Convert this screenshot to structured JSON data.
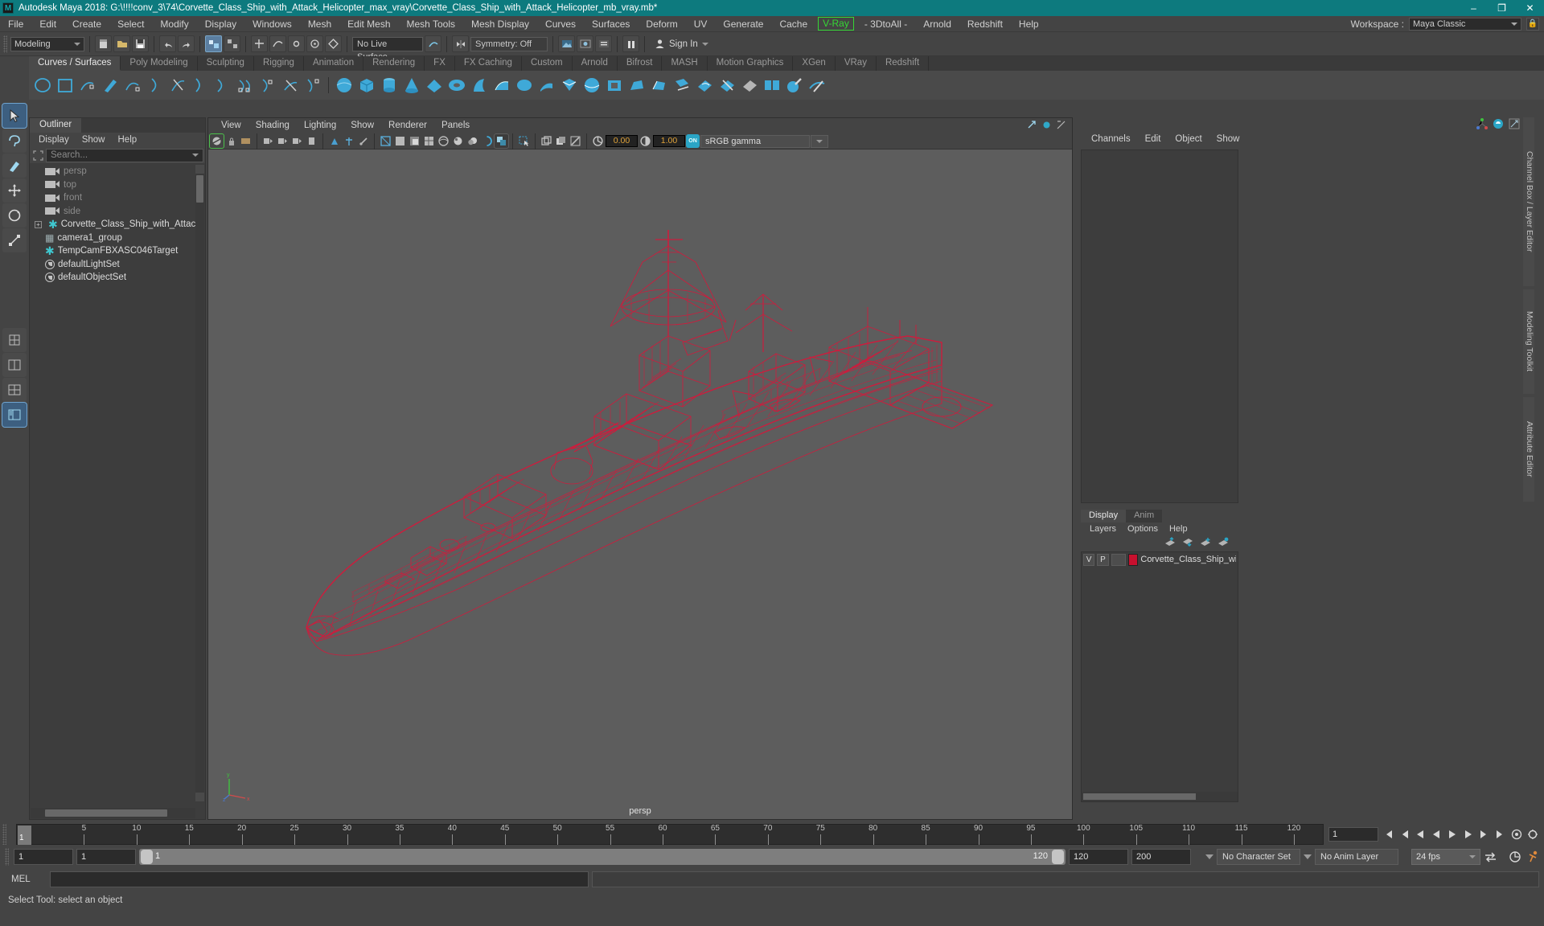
{
  "titlebar": {
    "app_title": "Autodesk Maya 2018: G:\\!!!!conv_3\\74\\Corvette_Class_Ship_with_Attack_Helicopter_max_vray\\Corvette_Class_Ship_with_Attack_Helicopter_mb_vray.mb*",
    "logo_letter": "M",
    "minimize": "–",
    "maximize": "❐",
    "close": "✕"
  },
  "menubar": {
    "items": [
      "File",
      "Edit",
      "Create",
      "Select",
      "Modify",
      "Display",
      "Windows",
      "Mesh",
      "Edit Mesh",
      "Mesh Tools",
      "Mesh Display",
      "Curves",
      "Surfaces",
      "Deform",
      "UV",
      "Generate",
      "Cache"
    ],
    "vray": "V-Ray",
    "after_vray": [
      "- 3DtoAll -",
      "Arnold",
      "Redshift",
      "Help"
    ],
    "workspace_label": "Workspace :",
    "workspace_value": "Maya Classic"
  },
  "statusline": {
    "mode": "Modeling",
    "no_live_surface": "No Live Surface",
    "symmetry": "Symmetry: Off",
    "signin": "Sign In"
  },
  "shelf": {
    "tabs": [
      "Curves / Surfaces",
      "Poly Modeling",
      "Sculpting",
      "Rigging",
      "Animation",
      "Rendering",
      "FX",
      "FX Caching",
      "Custom",
      "Arnold",
      "Bifrost",
      "MASH",
      "Motion Graphics",
      "XGen",
      "VRay",
      "Redshift"
    ],
    "active_tab": "Curves / Surfaces"
  },
  "outliner": {
    "tab_label": "Outliner",
    "menus": [
      "Display",
      "Show",
      "Help"
    ],
    "search_placeholder": "Search...",
    "items": [
      {
        "label": "persp",
        "icon": "camera-icon",
        "dim": true,
        "expand": false
      },
      {
        "label": "top",
        "icon": "camera-icon",
        "dim": true,
        "expand": false
      },
      {
        "label": "front",
        "icon": "camera-icon",
        "dim": true,
        "expand": false
      },
      {
        "label": "side",
        "icon": "camera-icon",
        "dim": true,
        "expand": false
      },
      {
        "label": "Corvette_Class_Ship_with_Attack_Hel",
        "icon": "transform-icon",
        "dim": false,
        "expand": true
      },
      {
        "label": "camera1_group",
        "icon": "group-icon",
        "dim": false,
        "expand": false
      },
      {
        "label": "TempCamFBXASC046Target",
        "icon": "transform-icon",
        "dim": false,
        "expand": false
      },
      {
        "label": "defaultLightSet",
        "icon": "set-icon",
        "dim": false,
        "expand": false
      },
      {
        "label": "defaultObjectSet",
        "icon": "set-icon",
        "dim": false,
        "expand": false
      }
    ]
  },
  "viewport": {
    "menus": [
      "View",
      "Shading",
      "Lighting",
      "Show",
      "Renderer",
      "Panels"
    ],
    "exposure_value": "0.00",
    "gamma_value": "1.00",
    "color_profile": "sRGB gamma",
    "camera_label": "persp",
    "background_color": "#5d5d5d",
    "wireframe_color": "#d21a3c",
    "axis_labels": {
      "y": "y",
      "x": "x",
      "z": "z"
    }
  },
  "channelbox": {
    "menus": [
      "Channels",
      "Edit",
      "Object",
      "Show"
    ],
    "side_tabs": [
      "Channel Box / Layer Editor",
      "Modeling Toolkit",
      "Attribute Editor"
    ]
  },
  "layereditor": {
    "tabs": [
      "Display",
      "Anim"
    ],
    "active_tab": "Display",
    "menus": [
      "Layers",
      "Options",
      "Help"
    ],
    "rows": [
      {
        "v": "V",
        "p": "P",
        "blank": "",
        "color": "#c8102e",
        "name": "Corvette_Class_Ship_with_Atta"
      }
    ]
  },
  "timeslider": {
    "current_frame": "1",
    "ticks": [
      5,
      10,
      15,
      20,
      25,
      30,
      35,
      40,
      45,
      50,
      55,
      60,
      65,
      70,
      75,
      80,
      85,
      90,
      95,
      100,
      105,
      110,
      115,
      120
    ],
    "end_field": "1"
  },
  "rangeslider": {
    "start_field": "1",
    "anim_start": "1",
    "range_start_label": "1",
    "range_end_label": "120",
    "anim_end": "120",
    "playback_end": "200",
    "character_set": "No Character Set",
    "anim_layer": "No Anim Layer",
    "fps": "24 fps"
  },
  "commandline": {
    "label": "MEL",
    "input_value": "",
    "output_value": ""
  },
  "helpline": {
    "text": "Select Tool: select an object"
  }
}
